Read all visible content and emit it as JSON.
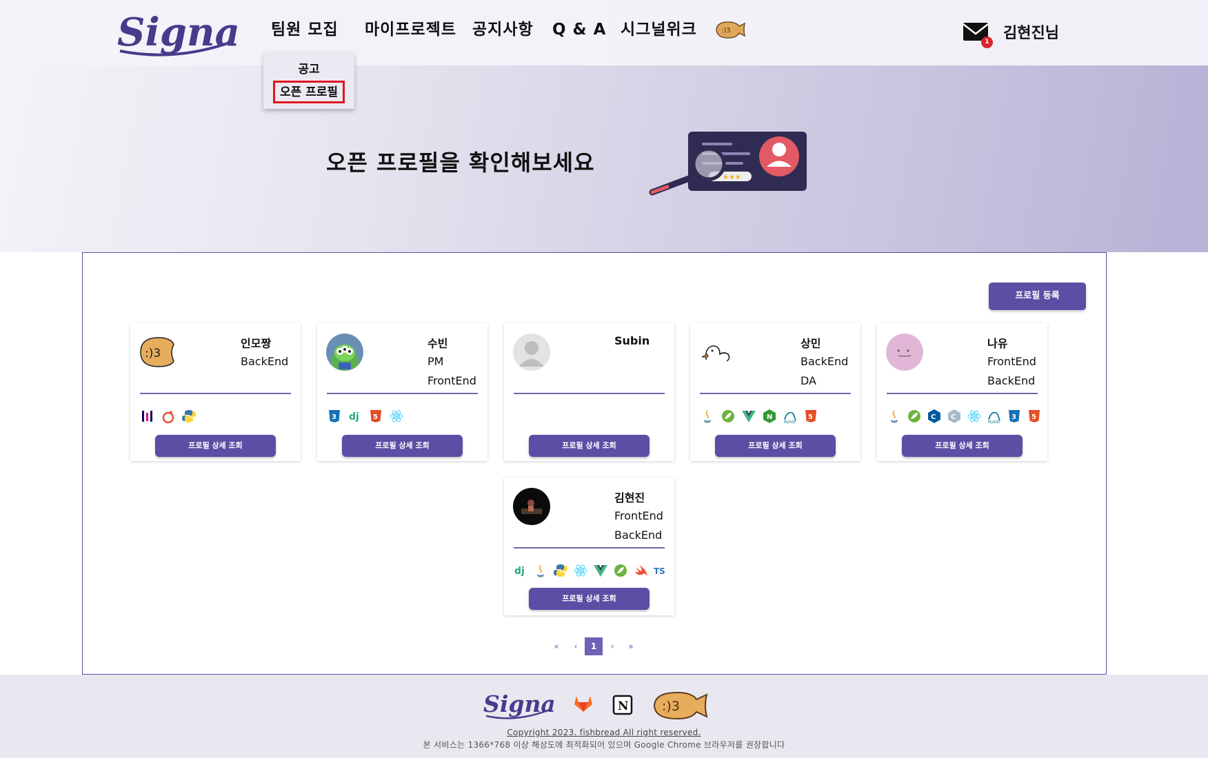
{
  "header": {
    "logo_text": "Signal",
    "nav": [
      "팀원 모집",
      "마이프로젝트",
      "공지사항",
      "Q & A",
      "시그널위크"
    ],
    "mail_badge": "1",
    "username": "김현진님",
    "dropdown": [
      "공고",
      "오픈 프로필"
    ]
  },
  "hero": {
    "title": "오픈 프로필을 확인해보세요"
  },
  "main": {
    "register_label": "프로필 등록",
    "detail_label": "프로필 상세 조회",
    "cards": [
      {
        "name": "인모짱",
        "roles": [
          "BackEnd"
        ],
        "avatar": "fishbread-avatar",
        "stack": [
          "pandas",
          "pytorch",
          "python"
        ]
      },
      {
        "name": "수빈",
        "roles": [
          "PM",
          "FrontEnd"
        ],
        "avatar": "alien-toy-avatar",
        "stack": [
          "css3",
          "django",
          "html5",
          "react"
        ]
      },
      {
        "name": "Subin",
        "roles": [],
        "avatar": "default-user-avatar",
        "stack": []
      },
      {
        "name": "상민",
        "roles": [
          "BackEnd",
          "DA"
        ],
        "avatar": "duck-sketch-avatar",
        "stack": [
          "java",
          "spring",
          "vue",
          "nodejs",
          "mysql",
          "html5"
        ]
      },
      {
        "name": "나유",
        "roles": [
          "FrontEnd",
          "BackEnd"
        ],
        "avatar": "pink-blob-avatar",
        "stack": [
          "java",
          "spring",
          "cplusplus",
          "c",
          "react",
          "mysql",
          "css3",
          "html5"
        ]
      },
      {
        "name": "김현진",
        "roles": [
          "FrontEnd",
          "BackEnd"
        ],
        "avatar": "dark-photo-avatar",
        "stack": [
          "django",
          "java",
          "python",
          "react",
          "vue",
          "spring",
          "swift",
          "typescript"
        ]
      }
    ],
    "pagination": {
      "first": "«",
      "prev": "‹",
      "current": "1",
      "next": "›",
      "last": "»"
    }
  },
  "footer": {
    "logo_text": "Signal",
    "copyright": "Copyright 2023. fishbread All right reserved.",
    "notice": "본 서비스는 1366*768 이상 해상도에 최적화되어 있으며 Google Chrome 브라우저를 권장합니다"
  },
  "colors": {
    "accent": "#5a4fa4",
    "logo": "#4a3a8c",
    "highlight_border": "#e0161f",
    "badge": "#d8262d"
  }
}
